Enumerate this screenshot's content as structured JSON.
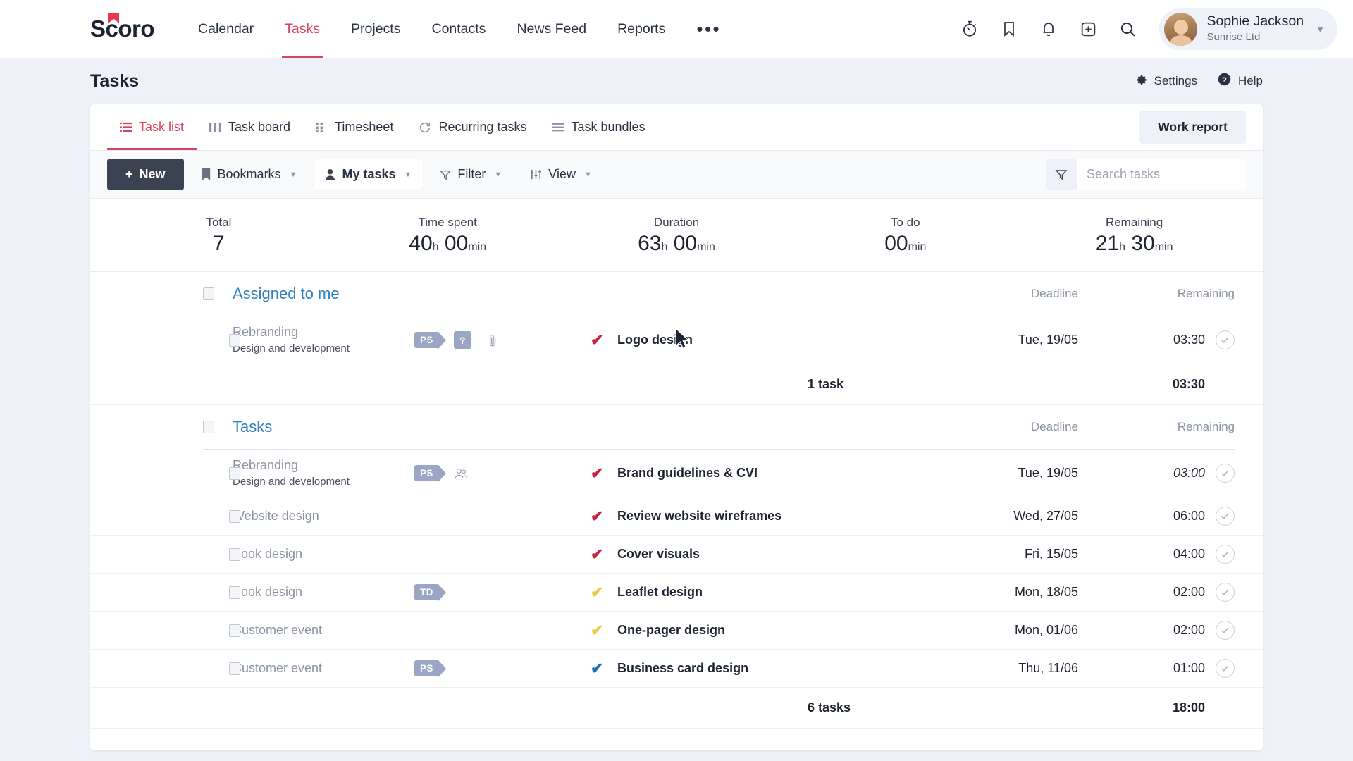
{
  "brand": {
    "logo_text": "coro",
    "logo_icon": "scoro-flag-icon"
  },
  "topnav": {
    "items": [
      {
        "label": "Calendar",
        "active": false
      },
      {
        "label": "Tasks",
        "active": true
      },
      {
        "label": "Projects",
        "active": false
      },
      {
        "label": "Contacts",
        "active": false
      },
      {
        "label": "News Feed",
        "active": false
      },
      {
        "label": "Reports",
        "active": false
      }
    ],
    "more_label": "•••",
    "icons": [
      "timer-icon",
      "bookmark-icon",
      "bell-icon",
      "plus-square-icon",
      "search-icon"
    ],
    "user": {
      "name": "Sophie Jackson",
      "org": "Sunrise Ltd"
    }
  },
  "page": {
    "title": "Tasks",
    "settings_label": "Settings",
    "help_label": "Help"
  },
  "tabs": [
    {
      "label": "Task list",
      "icon": "list-icon",
      "active": true
    },
    {
      "label": "Task board",
      "icon": "columns-icon",
      "active": false
    },
    {
      "label": "Timesheet",
      "icon": "grid-icon",
      "active": false
    },
    {
      "label": "Recurring tasks",
      "icon": "refresh-icon",
      "active": false
    },
    {
      "label": "Task bundles",
      "icon": "lines-icon",
      "active": false
    }
  ],
  "work_report_label": "Work report",
  "toolbar": {
    "new_label": "New",
    "bookmarks_label": "Bookmarks",
    "my_tasks_label": "My tasks",
    "filter_label": "Filter",
    "view_label": "View",
    "search_placeholder": "Search tasks",
    "search_value": ""
  },
  "stats": [
    {
      "label": "Total",
      "value": "7",
      "hours": "",
      "minutes": ""
    },
    {
      "label": "Time spent",
      "value": "",
      "hours": "40",
      "minutes": "00"
    },
    {
      "label": "Duration",
      "value": "",
      "hours": "63",
      "minutes": "00"
    },
    {
      "label": "To do",
      "value": "",
      "hours": "",
      "minutes": "00"
    },
    {
      "label": "Remaining",
      "value": "",
      "hours": "21",
      "minutes": "30"
    }
  ],
  "unit_hours": "h",
  "unit_minutes": "min",
  "columns": {
    "deadline": "Deadline",
    "remaining": "Remaining"
  },
  "sections": [
    {
      "title": "Assigned to me",
      "rows": [
        {
          "project": "Rebranding",
          "subproject": "Design and development",
          "tag": "PS",
          "question_badge": "?",
          "attachment": true,
          "people": false,
          "check_color": "#c8243f",
          "task": "Logo design",
          "deadline": "Tue, 19/05",
          "remaining": "03:30",
          "italic": false
        }
      ],
      "total_tasks": "1 task",
      "total_remaining": "03:30"
    },
    {
      "title": "Tasks",
      "rows": [
        {
          "project": "Rebranding",
          "subproject": "Design and development",
          "tag": "PS",
          "question_badge": "",
          "attachment": false,
          "people": true,
          "check_color": "#c8243f",
          "task": "Brand guidelines & CVI",
          "deadline": "Tue, 19/05",
          "remaining": "03:00",
          "italic": true
        },
        {
          "project": "Website design",
          "subproject": "",
          "tag": "",
          "question_badge": "",
          "attachment": false,
          "people": false,
          "check_color": "#c8243f",
          "task": "Review website wireframes",
          "deadline": "Wed, 27/05",
          "remaining": "06:00",
          "italic": false
        },
        {
          "project": "Book design",
          "subproject": "",
          "tag": "",
          "question_badge": "",
          "attachment": false,
          "people": false,
          "check_color": "#c8243f",
          "task": "Cover visuals",
          "deadline": "Fri, 15/05",
          "remaining": "04:00",
          "italic": false
        },
        {
          "project": "Book design",
          "subproject": "",
          "tag": "TD",
          "question_badge": "",
          "attachment": false,
          "people": false,
          "check_color": "#eccb4a",
          "task": "Leaflet design",
          "deadline": "Mon, 18/05",
          "remaining": "02:00",
          "italic": false
        },
        {
          "project": "Customer event",
          "subproject": "",
          "tag": "",
          "question_badge": "",
          "attachment": false,
          "people": false,
          "check_color": "#eccb4a",
          "task": "One-pager design",
          "deadline": "Mon, 01/06",
          "remaining": "02:00",
          "italic": false
        },
        {
          "project": "Customer event",
          "subproject": "",
          "tag": "PS",
          "question_badge": "",
          "attachment": false,
          "people": false,
          "check_color": "#1f6fb8",
          "task": "Business card design",
          "deadline": "Thu, 11/06",
          "remaining": "01:00",
          "italic": false
        }
      ],
      "total_tasks": "6 tasks",
      "total_remaining": "18:00"
    }
  ],
  "colors": {
    "accent_red": "#d6455d",
    "link_blue": "#2f7fc1",
    "tag_bg": "#9aa6c4",
    "dark_button": "#3b4252"
  }
}
